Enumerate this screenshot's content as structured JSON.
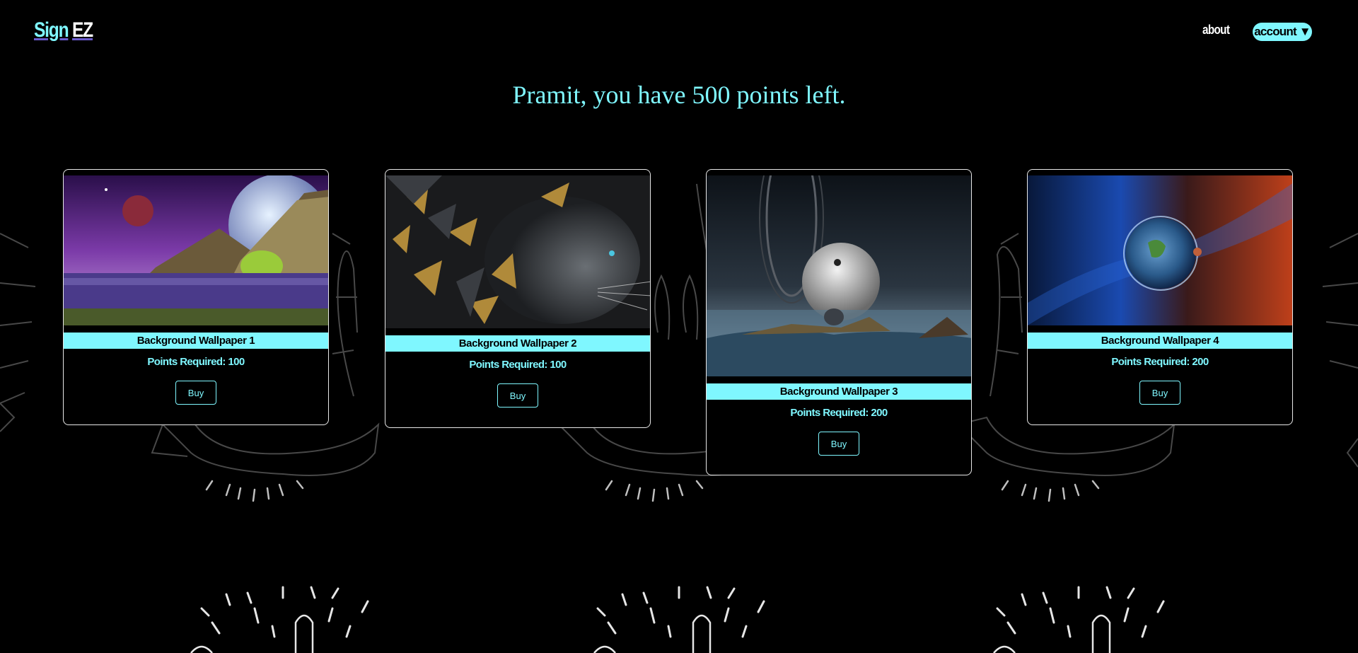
{
  "nav": {
    "logo_part1": "Sign",
    "logo_part2": "EZ",
    "about_label": "about",
    "account_label": "account ▼"
  },
  "heading": "Pramit, you have 500 points left.",
  "colors": {
    "accent": "#7ff7ff",
    "background": "#000000",
    "card_border": "#e8e8e8"
  },
  "products": [
    {
      "title": "Background Wallpaper 1",
      "points_label": "Points Required: 100",
      "points": 100,
      "buy_label": "Buy",
      "image": "space-landscape-image"
    },
    {
      "title": "Background Wallpaper 2",
      "points_label": "Points Required: 100",
      "points": 100,
      "buy_label": "Buy",
      "image": "leopard-image"
    },
    {
      "title": "Background Wallpaper 3",
      "points_label": "Points Required: 200",
      "points": 200,
      "buy_label": "Buy",
      "image": "planet-sea-image"
    },
    {
      "title": "Background Wallpaper 4",
      "points_label": "Points Required: 200",
      "points": 200,
      "buy_label": "Buy",
      "image": "earth-nebula-image"
    }
  ]
}
